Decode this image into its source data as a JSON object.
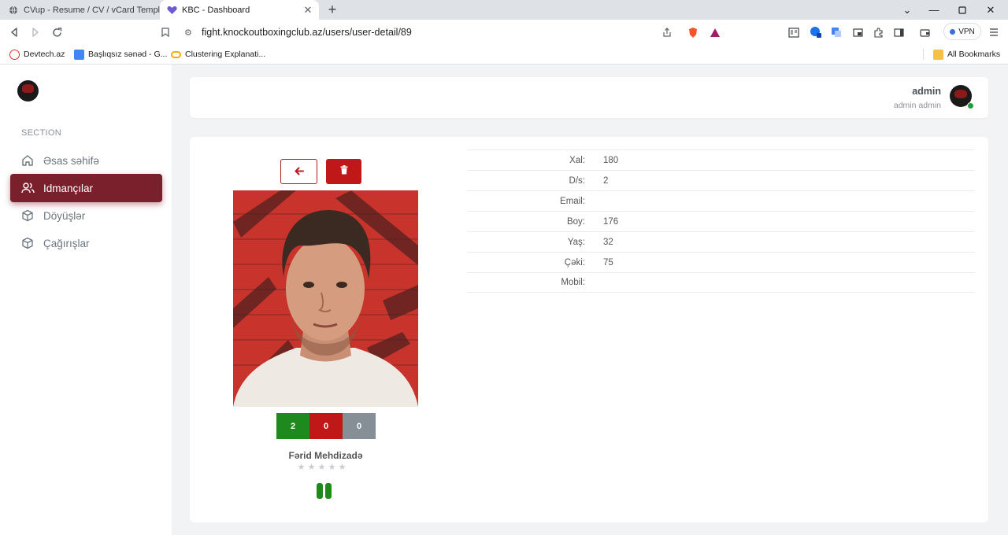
{
  "browser": {
    "tabs": [
      {
        "title": "CVup - Resume / CV / vCard Template",
        "active": false
      },
      {
        "title": "KBC - Dashboard",
        "active": true
      }
    ],
    "url": "fight.knockoutboxingclub.az/users/user-detail/89",
    "vpn_label": "VPN",
    "bookmarks": [
      {
        "label": "Devtech.az"
      },
      {
        "label": "Başlıqsız sənəd - G..."
      },
      {
        "label": "Clustering Explanati..."
      }
    ],
    "all_bookmarks_label": "All Bookmarks"
  },
  "sidebar": {
    "section_label": "SECTION",
    "items": [
      {
        "label": "Əsas səhifə",
        "icon": "home-icon",
        "active": false
      },
      {
        "label": "Idmançılar",
        "icon": "users-icon",
        "active": true
      },
      {
        "label": "Döyüşlər",
        "icon": "cube-icon",
        "active": false
      },
      {
        "label": "Çağırışlar",
        "icon": "cube-icon",
        "active": false
      }
    ]
  },
  "header": {
    "user_name": "admin",
    "user_role": "admin admin",
    "status": "online"
  },
  "athlete": {
    "name": "Fərid Mehdizadə",
    "record": {
      "wins": "2",
      "losses": "0",
      "draws": "0"
    },
    "rating_stars": 0,
    "rating_max": 5
  },
  "details": [
    {
      "label": "Xal:",
      "value": "180"
    },
    {
      "label": "D/s:",
      "value": "2"
    },
    {
      "label": "Email:",
      "value": ""
    },
    {
      "label": "Boy:",
      "value": "176"
    },
    {
      "label": "Yaş:",
      "value": "32"
    },
    {
      "label": "Çəki:",
      "value": "75"
    },
    {
      "label": "Mobil:",
      "value": ""
    }
  ],
  "colors": {
    "accent": "#7a1f2c",
    "danger": "#c01818",
    "win": "#1e8a1e",
    "loss": "#c01818",
    "draw": "#868e96"
  }
}
